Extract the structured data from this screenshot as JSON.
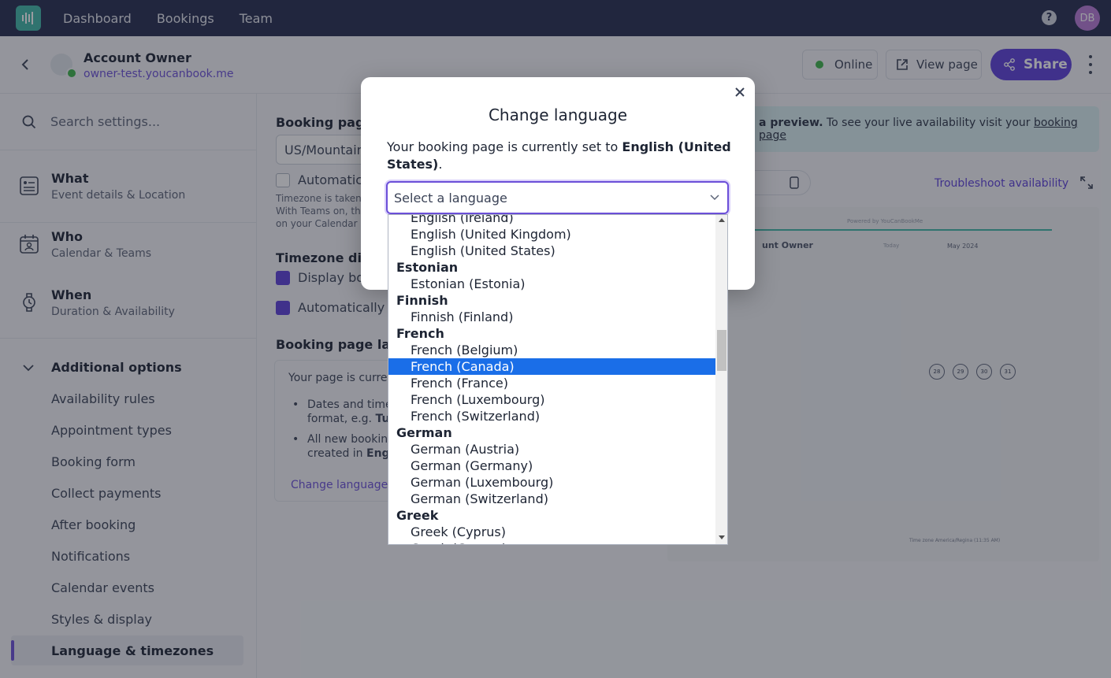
{
  "nav": {
    "items": [
      "Dashboard",
      "Bookings",
      "Team"
    ],
    "help_glyph": "?",
    "avatar_initials": "DB"
  },
  "header": {
    "account_name": "Account Owner",
    "account_url": "owner-test.youcanbook.me",
    "status_label": "Online",
    "view_page_label": "View page",
    "share_label": "Share"
  },
  "sidebar": {
    "search_placeholder": "Search settings...",
    "sections": [
      {
        "title": "What",
        "subtitle": "Event details & Location",
        "icon": "document-icon"
      },
      {
        "title": "Who",
        "subtitle": "Calendar & Teams",
        "icon": "calendar-person-icon"
      },
      {
        "title": "When",
        "subtitle": "Duration & Availability",
        "icon": "watch-icon"
      }
    ],
    "additional_title": "Additional options",
    "options": [
      "Availability rules",
      "Appointment types",
      "Booking form",
      "Collect payments",
      "After booking",
      "Notifications",
      "Calendar events",
      "Styles & display"
    ],
    "active_option": "Language & timezones"
  },
  "main": {
    "booking_page_tz_heading": "Booking page",
    "tz_value": "US/Mountain",
    "auto_label": "Automatica",
    "tz_note_1": "Timezone is taken f",
    "tz_note_2": "With Teams on, the",
    "tz_note_3": "on your Calendar &",
    "tz_display_heading": "Timezone disp",
    "display_label": "Display bo",
    "auto_detect_label": "Automatically d",
    "lang_heading": "Booking page lang",
    "box_line": "Your page is curren",
    "bullet1a": "Dates and times",
    "bullet1b": "format, e.g.",
    "bullet1b_bold": "Tue",
    "bullet2a": "All new booking",
    "bullet2b": "created in",
    "bullet2b_bold": "Engl",
    "change_link": "Change language s",
    "banner_bold": "a preview.",
    "banner_text": " To see your live availability visit your ",
    "banner_link": "booking page",
    "troubleshoot": "Troubleshoot availability",
    "preview_powered": "Powered by YouCanBookMe",
    "preview_owner": "unt Owner",
    "preview_today": "Today",
    "preview_month": "May 2024",
    "preview_dates": [
      "28",
      "29",
      "30",
      "31"
    ],
    "preview_tz": "Time zone  America/Regina (11:35 AM)"
  },
  "modal": {
    "title": "Change language",
    "desc_prefix": "Your booking page is currently set to ",
    "desc_bold": "English (United States)",
    "desc_suffix": ".",
    "select_placeholder": "Select a language"
  },
  "dropdown": {
    "items": [
      {
        "label": "English (Ireland)",
        "type": "option"
      },
      {
        "label": "English (United Kingdom)",
        "type": "option"
      },
      {
        "label": "English (United States)",
        "type": "option"
      },
      {
        "label": "Estonian",
        "type": "group"
      },
      {
        "label": "Estonian (Estonia)",
        "type": "option"
      },
      {
        "label": "Finnish",
        "type": "group"
      },
      {
        "label": "Finnish (Finland)",
        "type": "option"
      },
      {
        "label": "French",
        "type": "group"
      },
      {
        "label": "French (Belgium)",
        "type": "option"
      },
      {
        "label": "French (Canada)",
        "type": "option",
        "selected": true
      },
      {
        "label": "French (France)",
        "type": "option"
      },
      {
        "label": "French (Luxembourg)",
        "type": "option"
      },
      {
        "label": "French (Switzerland)",
        "type": "option"
      },
      {
        "label": "German",
        "type": "group"
      },
      {
        "label": "German (Austria)",
        "type": "option"
      },
      {
        "label": "German (Germany)",
        "type": "option"
      },
      {
        "label": "German (Luxembourg)",
        "type": "option"
      },
      {
        "label": "German (Switzerland)",
        "type": "option"
      },
      {
        "label": "Greek",
        "type": "group"
      },
      {
        "label": "Greek (Cyprus)",
        "type": "option"
      },
      {
        "label": "Greek (Greece)",
        "type": "option"
      }
    ]
  },
  "colors": {
    "nav_bg": "#232b4d",
    "accent": "#5b3fd9",
    "online": "#3cb54a",
    "selected_option": "#1a6ee8"
  }
}
